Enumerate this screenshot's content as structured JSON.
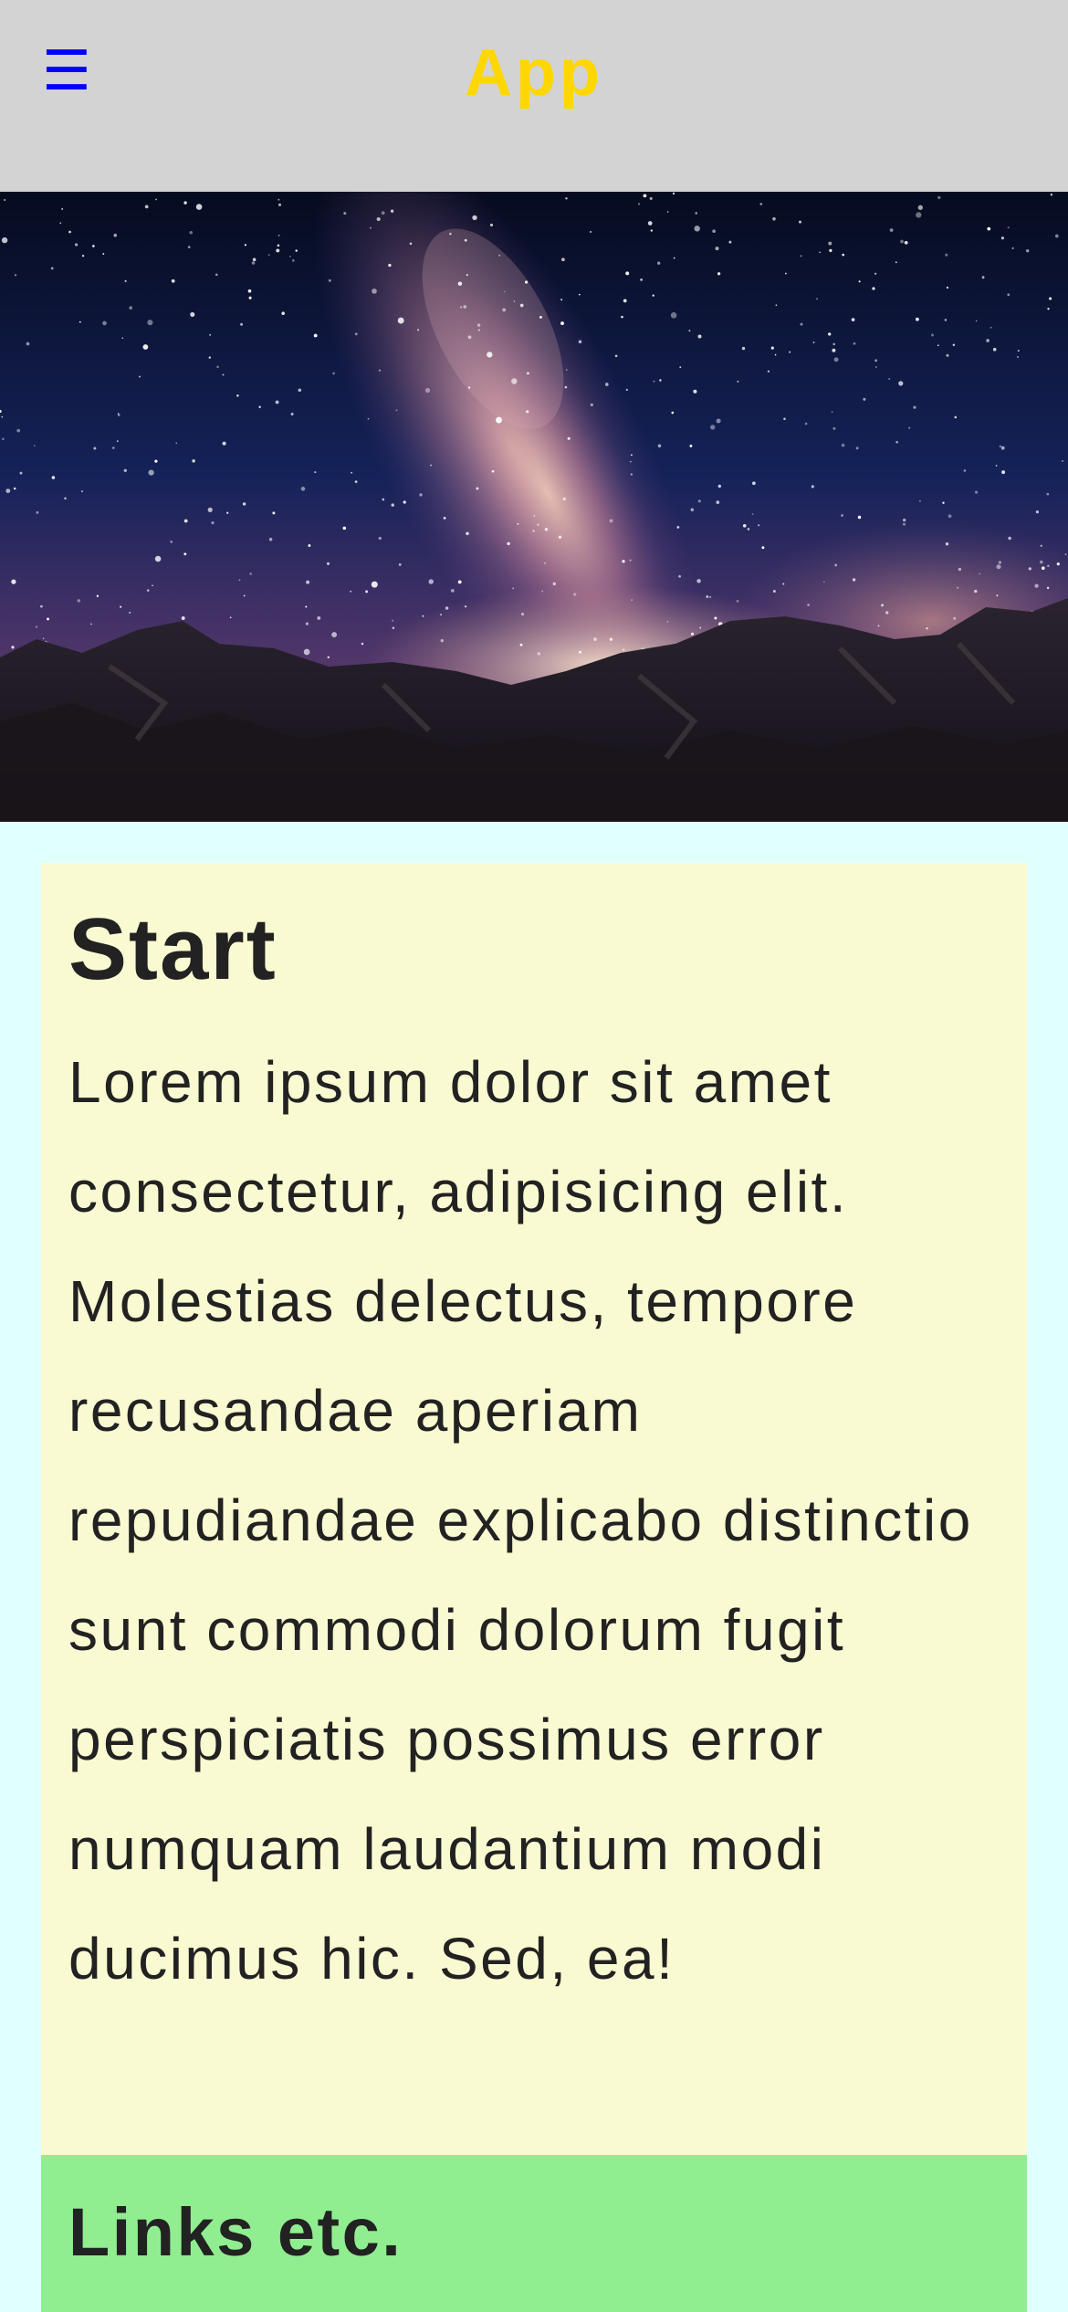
{
  "header": {
    "menu_icon": "hamburger-menu-icon",
    "menu_glyph": "☰",
    "title": "App"
  },
  "hero": {
    "image": "milky-way-over-mountains"
  },
  "start_section": {
    "heading": "Start",
    "body": "Lorem ipsum dolor sit amet consectetur, adipisicing elit. Molestias delectus, tempore recusandae aperiam repudiandae explicabo distinctio sunt commodi dolorum fugit perspiciatis possimus error numquam laudantium modi ducimus hic. Sed, ea!"
  },
  "links_section": {
    "heading": "Links etc."
  },
  "colors": {
    "header_bg": "#d3d3d3",
    "title": "#ffd700",
    "menu_icon": "#0000ff",
    "page_bg": "#e0ffff",
    "start_bg": "#fafad2",
    "links_bg": "#90ee90"
  }
}
